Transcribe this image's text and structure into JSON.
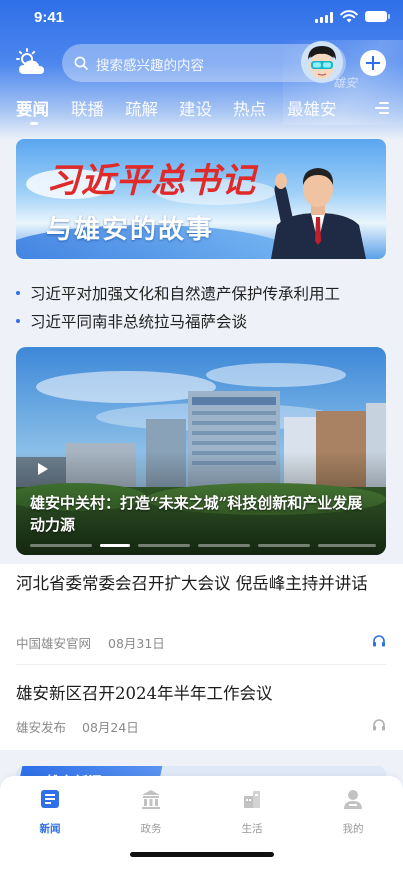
{
  "status_bar": {
    "time": "9:41"
  },
  "header": {
    "search_placeholder": "搜索感兴趣的内容",
    "brand_watermark": "雄安"
  },
  "tabs": [
    {
      "label": "要闻",
      "active": true
    },
    {
      "label": "联播",
      "active": false
    },
    {
      "label": "疏解",
      "active": false
    },
    {
      "label": "建设",
      "active": false
    },
    {
      "label": "热点",
      "active": false
    },
    {
      "label": "最雄安",
      "active": false
    }
  ],
  "banner": {
    "line1": "习近平总书记",
    "line2": "与雄安的故事"
  },
  "headlines": [
    "习近平对加强文化和自然遗产保护传承利用工",
    "习近平同南非总统拉马福萨会谈"
  ],
  "hero": {
    "caption": "雄安中关村：打造“未来之城”科技创新和产业发展动力源",
    "carousel_active_index": 1,
    "carousel_count": 6
  },
  "news_items": [
    {
      "title": "河北省委常委会召开扩大会议 倪岳峰主持并讲话",
      "source": "中国雄安官网",
      "date": "08月31日",
      "audio_active": true
    },
    {
      "title": "雄安新区召开2024年半年工作会议",
      "source": "雄安发布",
      "date": "08月24日",
      "audio_active": false
    }
  ],
  "peek_section": {
    "label": "雄安新闻"
  },
  "tab_bar": [
    {
      "label": "新闻",
      "icon": "news-icon",
      "active": true
    },
    {
      "label": "政务",
      "icon": "government-icon",
      "active": false
    },
    {
      "label": "生活",
      "icon": "life-icon",
      "active": false
    },
    {
      "label": "我的",
      "icon": "profile-icon",
      "active": false
    }
  ],
  "colors": {
    "accent": "#2f6fe8",
    "banner_red": "#e02a2a"
  }
}
